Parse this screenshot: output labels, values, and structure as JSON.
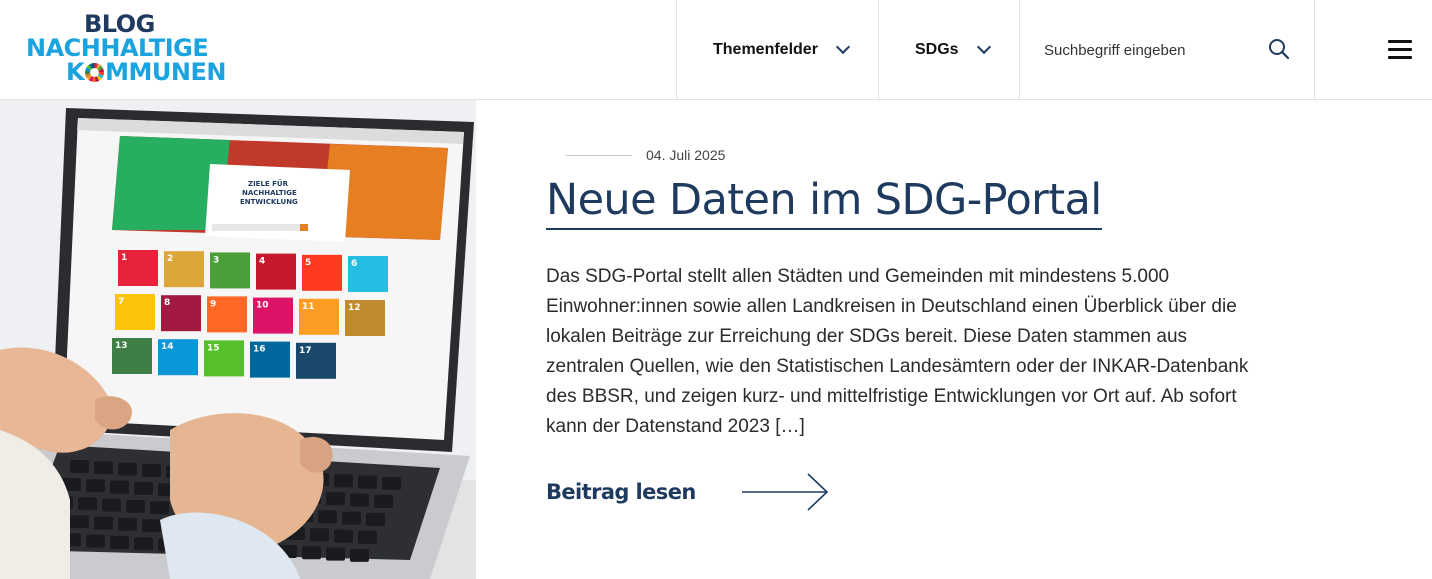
{
  "brand": {
    "logo_line1": "BLOG",
    "logo_line2": "NACHHALTIGE",
    "logo_line3_a": "K",
    "logo_line3_b": "MMUNEN",
    "primary_color": "#1e3a5f",
    "accent_color": "#1aa3de"
  },
  "nav": {
    "items": [
      {
        "label": "Themenfelder",
        "icon": "chevron-down-icon"
      },
      {
        "label": "SDGs",
        "icon": "chevron-down-icon"
      }
    ],
    "search_placeholder": "Suchbegriff eingeben",
    "search_icon": "search-icon",
    "menu_icon": "hamburger-menu-icon"
  },
  "article": {
    "date": "04. Juli 2025",
    "title": "Neue Daten im SDG-Portal",
    "excerpt": "Das SDG-Portal stellt allen Städten und Gemeinden mit mindestens 5.000 Einwohner:innen sowie allen Landkreisen in Deutschland einen Überblick über die lokalen Beiträge zur Erreichung der SDGs bereit. Diese Daten stammen aus zentralen Quellen, wie den Statistischen Landesämtern oder der INKAR-Datenbank des BBSR, und zeigen kurz- und mittelfristige Entwicklungen vor Ort auf. Ab sofort kann der Datenstand 2023 […]",
    "read_more": "Beitrag lesen",
    "read_more_icon": "arrow-right-icon"
  },
  "hero": {
    "screen_title": "ZIELE FÜR NACHHALTIGE ENTWICKLUNG",
    "sdg_colors": [
      "#e5243b",
      "#dda63a",
      "#4c9f38",
      "#c5192d",
      "#ff3a21",
      "#26bde2",
      "#fcc30b",
      "#a21942",
      "#fd6925",
      "#dd1367",
      "#fd9d24",
      "#bf8b2e",
      "#3f7e44",
      "#0a97d9",
      "#56c02b",
      "#00689d",
      "#19486a"
    ],
    "sdg_numbers": [
      "1",
      "2",
      "3",
      "4",
      "5",
      "6",
      "7",
      "8",
      "9",
      "10",
      "11",
      "12",
      "13",
      "14",
      "15",
      "16",
      "17"
    ]
  }
}
